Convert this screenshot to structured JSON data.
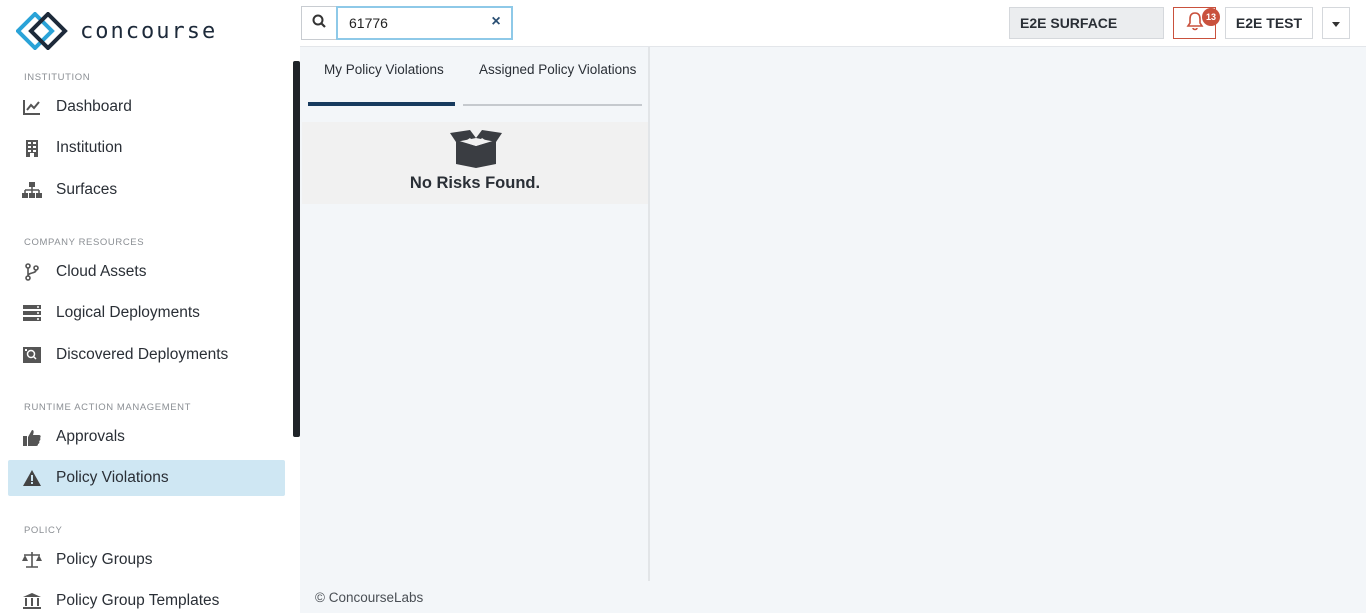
{
  "brand": {
    "name": "concourse"
  },
  "sidebar": {
    "sections": [
      {
        "label": "INSTITUTION"
      },
      {
        "label": "COMPANY RESOURCES"
      },
      {
        "label": "RUNTIME ACTION MANAGEMENT"
      },
      {
        "label": "POLICY"
      }
    ],
    "items": [
      {
        "label": "Dashboard",
        "icon": "chart-line-icon"
      },
      {
        "label": "Institution",
        "icon": "building-icon"
      },
      {
        "label": "Surfaces",
        "icon": "sitemap-icon"
      },
      {
        "label": "Cloud Assets",
        "icon": "code-branch-icon"
      },
      {
        "label": "Logical Deployments",
        "icon": "server-icon"
      },
      {
        "label": "Discovered Deployments",
        "icon": "search-server-icon"
      },
      {
        "label": "Approvals",
        "icon": "thumbs-up-icon"
      },
      {
        "label": "Policy Violations",
        "icon": "warning-icon",
        "active": true
      },
      {
        "label": "Policy Groups",
        "icon": "balance-scale-icon"
      },
      {
        "label": "Policy Group Templates",
        "icon": "landmark-icon"
      }
    ]
  },
  "topbar": {
    "search": {
      "value": "61776",
      "clear": "×"
    },
    "surface": "E2E SURFACE",
    "notifications": {
      "count": "13"
    },
    "user": "E2E TEST"
  },
  "main": {
    "tabs": [
      {
        "label": "My Policy Violations",
        "active": true
      },
      {
        "label": "Assigned Policy Violations",
        "active": false
      }
    ],
    "empty_state": "No Risks Found.",
    "footer": "© ConcourseLabs"
  },
  "colors": {
    "accent": "#173a5e",
    "active_bg": "#cfe7f3",
    "alert": "#c9513d"
  }
}
